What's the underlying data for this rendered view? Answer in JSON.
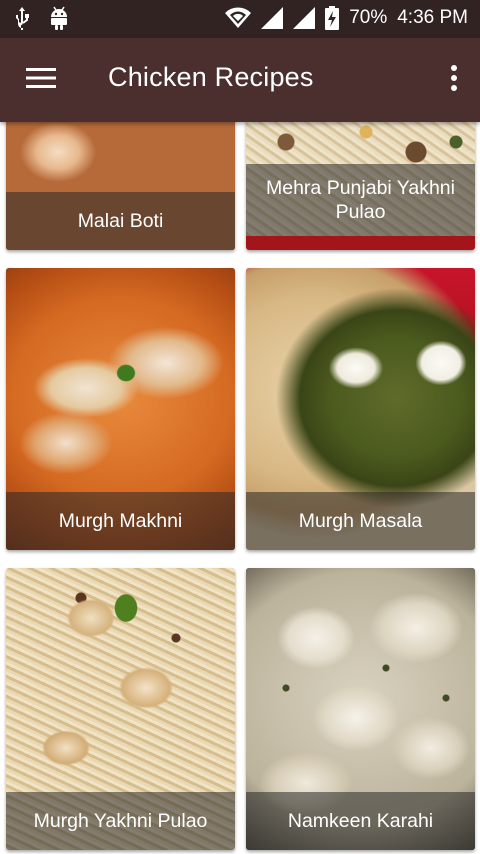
{
  "status_bar": {
    "battery_percent": "70%",
    "time": "4:36 PM",
    "icons": [
      "usb-icon",
      "android-icon",
      "wifi-icon",
      "signal-icon",
      "signal-icon",
      "battery-charging-icon"
    ]
  },
  "app_bar": {
    "title": "Chicken Recipes",
    "menu_icon": "hamburger-menu-icon",
    "overflow_icon": "more-vertical-icon",
    "background_color": "#4a2f2e",
    "status_bar_color": "#302322"
  },
  "recipes": [
    {
      "name": "Malai Boti"
    },
    {
      "name": "Mehra Punjabi Yakhni Pulao"
    },
    {
      "name": "Murgh Makhni"
    },
    {
      "name": "Murgh Masala"
    },
    {
      "name": "Murgh Yakhni Pulao"
    },
    {
      "name": "Namkeen Karahi"
    }
  ]
}
